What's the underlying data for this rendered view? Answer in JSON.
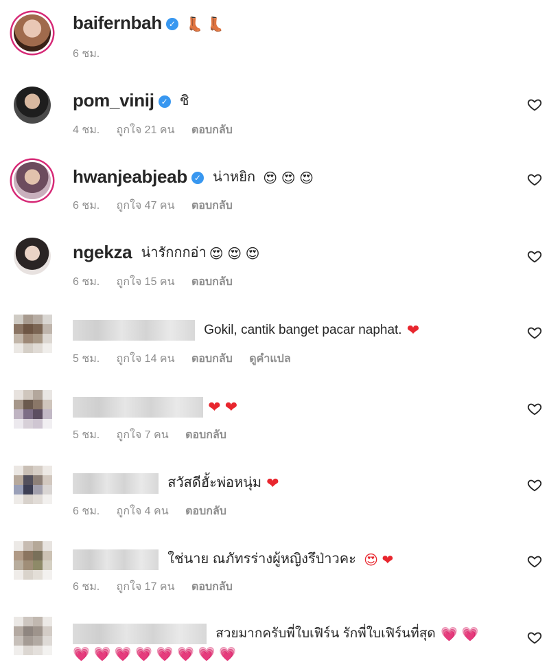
{
  "comments": [
    {
      "username": "baifernbah",
      "verified": true,
      "text": "",
      "emoji": "👢 👢",
      "time": "6 ชม.",
      "likes": "",
      "reply": "",
      "translate": "",
      "liked_icon": false
    },
    {
      "username": "pom_vinij",
      "verified": true,
      "text": "ชิ",
      "emoji": "",
      "time": "4 ชม.",
      "likes": "ถูกใจ 21 คน",
      "reply": "ตอบกลับ",
      "translate": "",
      "liked_icon": true
    },
    {
      "username": "hwanjeabjeab",
      "verified": true,
      "text": "น่าหยิก",
      "emoji": "😍 😍 😍",
      "time": "6 ชม.",
      "likes": "ถูกใจ 47 คน",
      "reply": "ตอบกลับ",
      "translate": "",
      "liked_icon": true
    },
    {
      "username": "ngekza",
      "verified": false,
      "text": "น่ารักกกอ่า",
      "emoji": "😍 😍 😍",
      "time": "6 ชม.",
      "likes": "ถูกใจ 15 คน",
      "reply": "ตอบกลับ",
      "translate": "",
      "liked_icon": true
    },
    {
      "username": "",
      "verified": false,
      "text": "Gokil, cantik banget pacar naphat.",
      "emoji": "❤",
      "time": "5 ชม.",
      "likes": "ถูกใจ 14 คน",
      "reply": "ตอบกลับ",
      "translate": "ดูคำแปล",
      "liked_icon": true
    },
    {
      "username": "",
      "verified": false,
      "text": "",
      "emoji": "❤ ❤",
      "time": "5 ชม.",
      "likes": "ถูกใจ 7 คน",
      "reply": "ตอบกลับ",
      "translate": "",
      "liked_icon": true
    },
    {
      "username": "",
      "verified": false,
      "text": "สวัสดีฮั้ะพ่อหนุ่ม",
      "emoji": "❤",
      "time": "6 ชม.",
      "likes": "ถูกใจ 4 คน",
      "reply": "ตอบกลับ",
      "translate": "",
      "liked_icon": true
    },
    {
      "username": "",
      "verified": false,
      "text": "ใช่นาย ณภัทรร่างผู้หญิงรึป่าวคะ",
      "emoji": "😍 ❤",
      "time": "6 ชม.",
      "likes": "ถูกใจ 17 คน",
      "reply": "ตอบกลับ",
      "translate": "",
      "liked_icon": true
    },
    {
      "username": "",
      "verified": false,
      "text": "สวยมากครับพี่ใบเฟิร์น รักพี่ใบเฟิร์นที่สุด",
      "emoji": "💗 💗",
      "emoji_line2": "💗 💗 💗 💗 💗 💗 💗 💗",
      "time": "",
      "likes": "",
      "reply": "",
      "translate": "",
      "liked_icon": true
    }
  ]
}
